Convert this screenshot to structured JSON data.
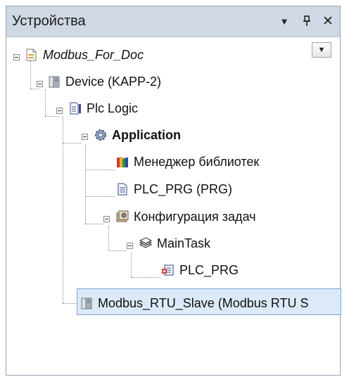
{
  "panel": {
    "title": "Устройства",
    "dropdown_glyph": "▼",
    "pin_glyph": "ᵖ",
    "close_glyph": "✕",
    "combo_glyph": "▼"
  },
  "tree": {
    "items": [
      {
        "label": "Modbus_For_Doc",
        "icon": "project-icon",
        "style": "italic"
      },
      {
        "label": "Device (KAPP-2)",
        "icon": "device-icon",
        "style": "normal"
      },
      {
        "label": "Plc Logic",
        "icon": "plc-logic-icon",
        "style": "normal"
      },
      {
        "label": "Application",
        "icon": "application-gear-icon",
        "style": "bold"
      },
      {
        "label": "Менеджер библиотек",
        "icon": "library-manager-icon",
        "style": "normal"
      },
      {
        "label": "PLC_PRG (PRG)",
        "icon": "program-document-icon",
        "style": "normal"
      },
      {
        "label": "Конфигурация задач",
        "icon": "task-configuration-icon",
        "style": "normal"
      },
      {
        "label": "MainTask",
        "icon": "main-task-icon",
        "style": "normal"
      },
      {
        "label": "PLC_PRG",
        "icon": "program-call-icon",
        "style": "normal"
      },
      {
        "label": "Modbus_RTU_Slave (Modbus RTU S",
        "icon": "device-icon",
        "style": "normal",
        "selected": true
      }
    ]
  },
  "colors": {
    "titlebar": "#cfd8e4",
    "selection": "#dce9f8",
    "selection_border": "#7ea7d8"
  }
}
